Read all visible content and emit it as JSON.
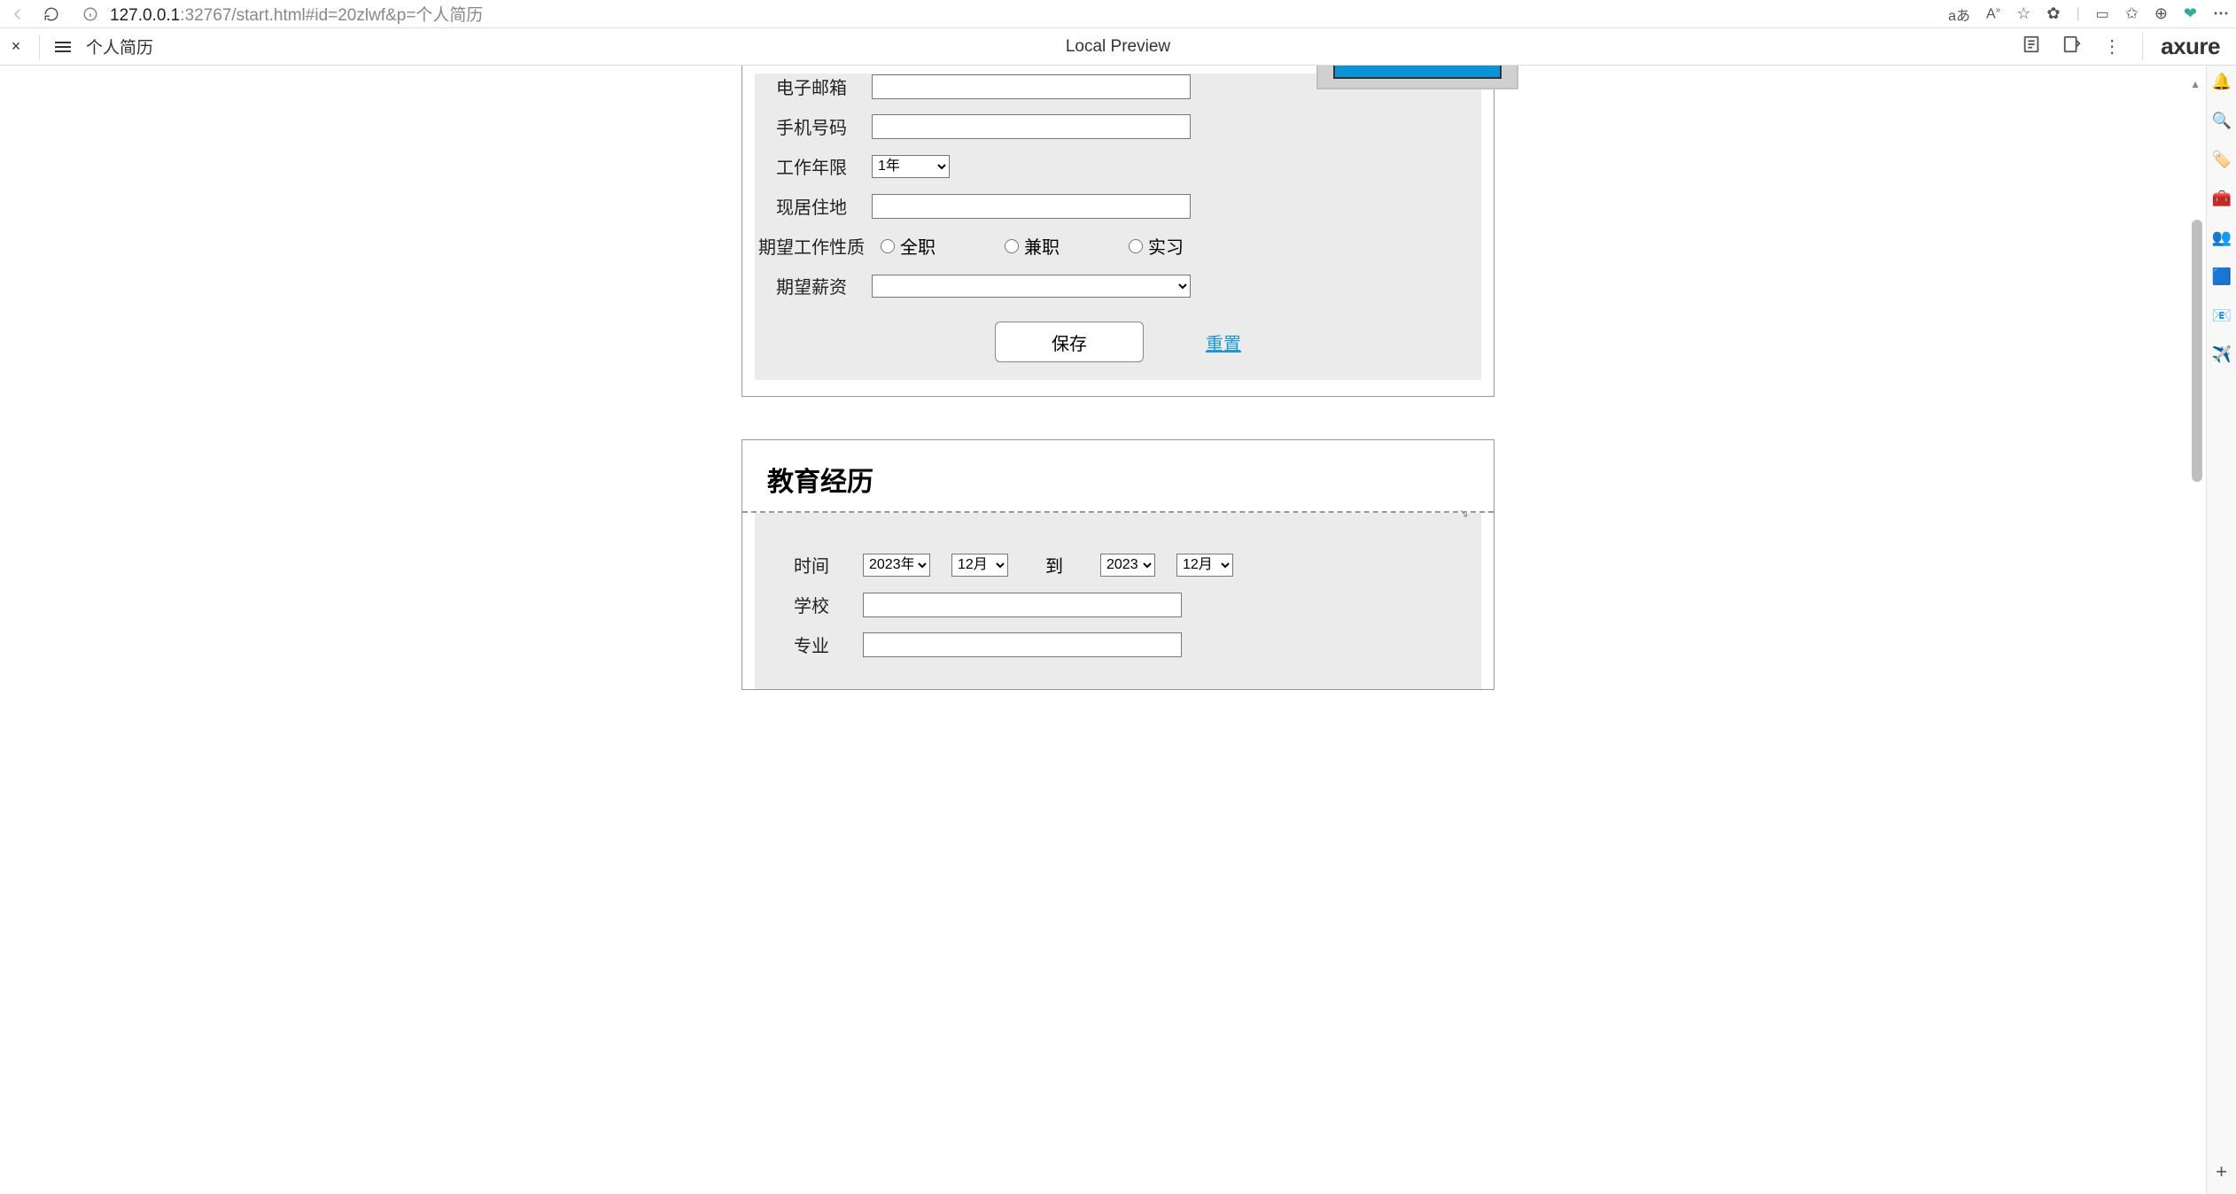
{
  "browser": {
    "url_host": "127.0.0.1",
    "url_port": ":32767",
    "url_path": "/start.html#id=20zlwf&p=个人简历",
    "translate": "aあ",
    "text_size": "A"
  },
  "axure": {
    "page_name": "个人简历",
    "center_label": "Local Preview",
    "logo": "axure"
  },
  "form": {
    "labels": {
      "email": "电子邮箱",
      "phone": "手机号码",
      "work_years": "工作年限",
      "residence": "现居住地",
      "job_type": "期望工作性质",
      "salary": "期望薪资"
    },
    "work_years_value": "1年",
    "job_types": {
      "full": "全职",
      "part": "兼职",
      "intern": "实习"
    },
    "buttons": {
      "save": "保存",
      "reset": "重置"
    }
  },
  "edu": {
    "title": "教育经历",
    "labels": {
      "time": "时间",
      "to": "到",
      "school": "学校",
      "major": "专业"
    },
    "year1": "2023年",
    "month1": "12月",
    "year2": "2023",
    "month2": "12月"
  }
}
